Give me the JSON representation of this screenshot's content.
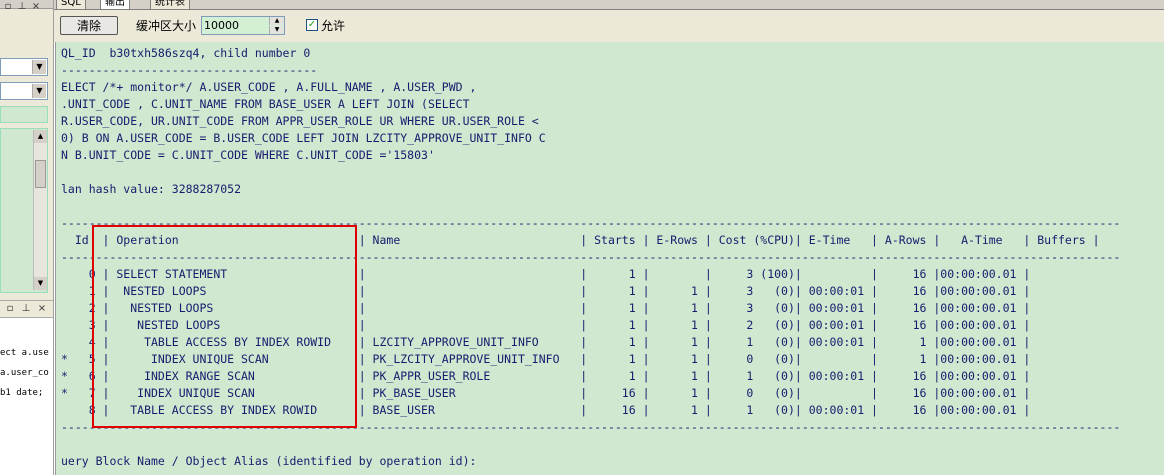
{
  "tabs": [
    {
      "label": "SQL"
    },
    {
      "label": "输出"
    },
    {
      "label": "统计表"
    }
  ],
  "toolbar": {
    "clear_label": "清除",
    "buffer_label": "缓冲区大小",
    "buffer_value": "10000",
    "enable_label": "允许",
    "enable_checked": true
  },
  "left_panel": {
    "code_lines": [
      "ect a.use",
      "a.user_co",
      "b1 date;"
    ]
  },
  "output": {
    "lines": [
      "QL_ID  b30txh586szq4, child number 0",
      "-------------------------------------",
      "ELECT /*+ monitor*/ A.USER_CODE , A.FULL_NAME , A.USER_PWD ,",
      ".UNIT_CODE , C.UNIT_NAME FROM BASE_USER A LEFT JOIN (SELECT",
      "R.USER_CODE, UR.UNIT_CODE FROM APPR_USER_ROLE UR WHERE UR.USER_ROLE <",
      "0) B ON A.USER_CODE = B.USER_CODE LEFT JOIN LZCITY_APPROVE_UNIT_INFO C",
      "N B.UNIT_CODE = C.UNIT_CODE WHERE C.UNIT_CODE ='15803'",
      "",
      "lan hash value: 3288287052",
      "",
      "---------------------------------------------------------------------------------------------------------------------------------------------------------",
      "  Id  | Operation                          | Name                          | Starts | E-Rows | Cost (%CPU)| E-Time   | A-Rows |   A-Time   | Buffers |",
      "---------------------------------------------------------------------------------------------------------------------------------------------------------",
      "    0 | SELECT STATEMENT                   |                               |      1 |        |     3 (100)|          |     16 |00:00:00.01 |",
      "    1 |  NESTED LOOPS                      |                               |      1 |      1 |     3   (0)| 00:00:01 |     16 |00:00:00.01 |",
      "    2 |   NESTED LOOPS                     |                               |      1 |      1 |     3   (0)| 00:00:01 |     16 |00:00:00.01 |",
      "    3 |    NESTED LOOPS                    |                               |      1 |      1 |     2   (0)| 00:00:01 |     16 |00:00:00.01 |",
      "    4 |     TABLE ACCESS BY INDEX ROWID    | LZCITY_APPROVE_UNIT_INFO      |      1 |      1 |     1   (0)| 00:00:01 |      1 |00:00:00.01 |",
      "*   5 |      INDEX UNIQUE SCAN             | PK_LZCITY_APPROVE_UNIT_INFO   |      1 |      1 |     0   (0)|          |      1 |00:00:00.01 |",
      "*   6 |     INDEX RANGE SCAN               | PK_APPR_USER_ROLE             |      1 |      1 |     1   (0)| 00:00:01 |     16 |00:00:00.01 |",
      "*   7 |    INDEX UNIQUE SCAN               | PK_BASE_USER                  |     16 |      1 |     0   (0)|          |     16 |00:00:00.01 |",
      "    8 |   TABLE ACCESS BY INDEX ROWID      | BASE_USER                     |     16 |      1 |     1   (0)| 00:00:01 |     16 |00:00:00.01 |",
      "---------------------------------------------------------------------------------------------------------------------------------------------------------",
      "",
      "uery Block Name / Object Alias (identified by operation id):"
    ]
  }
}
